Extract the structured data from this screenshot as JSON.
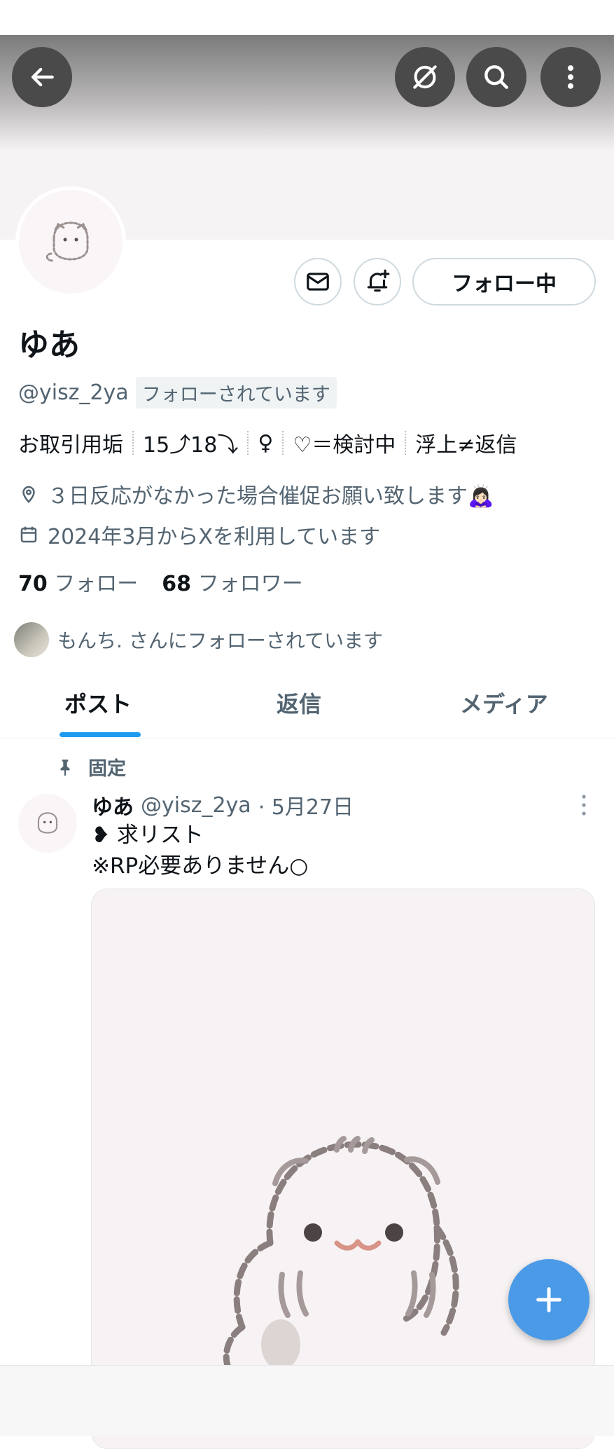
{
  "profile": {
    "name": "ゆあ",
    "handle": "@yisz_2ya",
    "follows_you_badge": "フォローされています",
    "follow_button_label": "フォロー中",
    "bio": [
      "お取引用垢",
      "15⤴18⤵",
      "♀",
      "♡＝検討中",
      "浮上≠返信"
    ],
    "location": "３日反応がなかった場合催促お願い致します🙇🏻‍♀️",
    "joined": "2024年3月からXを利用しています",
    "following_count": "70",
    "following_label": "フォロー",
    "followers_count": "68",
    "followers_label": "フォロワー",
    "followed_by_text": "もんち. さんにフォローされています"
  },
  "header_icons": [
    "back-arrow-icon",
    "grok-icon",
    "search-icon",
    "more-vertical-icon"
  ],
  "action_icons": [
    "mail-icon",
    "bell-plus-icon"
  ],
  "tabs": [
    {
      "label": "ポスト",
      "active": true
    },
    {
      "label": "返信",
      "active": false
    },
    {
      "label": "メディア",
      "active": false
    }
  ],
  "pinned_post": {
    "pinned_label": "固定",
    "author_name": "ゆあ",
    "author_handle": "@yisz_2ya",
    "date": "· 5月27日",
    "line1": "❥ 求リスト",
    "line2": "※RP必要ありません○"
  },
  "colors": {
    "accent": "#1d9bf0",
    "fab": "#4a9ae8",
    "secondary_text": "#536471"
  }
}
